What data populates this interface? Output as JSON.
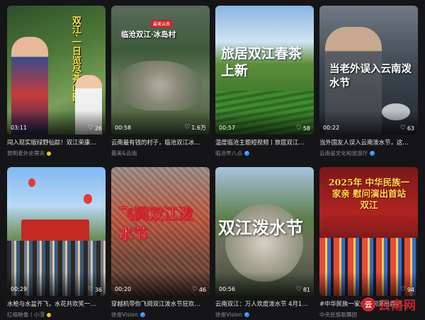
{
  "cards": [
    {
      "duration": "03:11",
      "likes": "26",
      "title": "闯入现实版绿野仙踪！双江荣康…",
      "author": "昆明老外史蒂夫",
      "badge": "yellow-dot",
      "overlay": "双江·一日览尽茶山韵"
    },
    {
      "duration": "00:58",
      "likes": "1.6万",
      "title": "云南最有钱的村子，临沧双江冰…",
      "author": "最美&云南",
      "badge": "",
      "tag": "最美云南",
      "overlay": "临沧双江·冰岛村"
    },
    {
      "duration": "00:57",
      "likes": "58",
      "title": "温度临沧主题短视频丨旅居双江…",
      "author": "临沧早八点",
      "badge": "verified",
      "overlay": "旅居双江春茶上新"
    },
    {
      "duration": "00:22",
      "likes": "63",
      "title": "当外国友人误入云南泼水节，这…",
      "author": "云南省文化和旅游厅",
      "badge": "verified",
      "overlay": "当老外误入云南泼水节"
    },
    {
      "duration": "00:29",
      "likes": "36",
      "title": "水枪与水盆齐飞，水花共欢笑一…",
      "author": "红格映像丨小澋",
      "badge": "yellow-dot",
      "overlay": ""
    },
    {
      "duration": "00:20",
      "likes": "46",
      "title": "穿越机带你飞阅双江泼水节狂欢…",
      "author": "徐俊Vision",
      "badge": "verified",
      "overlay": "飞阅双江泼水节"
    },
    {
      "duration": "00:56",
      "likes": "81",
      "title": "云南双江：万人欢度泼水节 4月1…",
      "author": "徐俊Vision",
      "badge": "verified",
      "overlay": "双江泼水节"
    },
    {
      "duration": "",
      "likes": "94",
      "title": "#中华民族一家亲慰问演出首站…",
      "author": "中央民族歌舞团",
      "badge": "",
      "overlay": "2025年 中华民族一家亲 慰问演出首站 双江"
    }
  ],
  "watermark": {
    "logo": "云",
    "text": "云南网"
  },
  "icons": {
    "like": "heart-icon",
    "verified": "verified-badge-icon"
  },
  "colors": {
    "background": "#151517",
    "accent_red": "#c8252b",
    "verified_blue": "#3b8cf5"
  }
}
